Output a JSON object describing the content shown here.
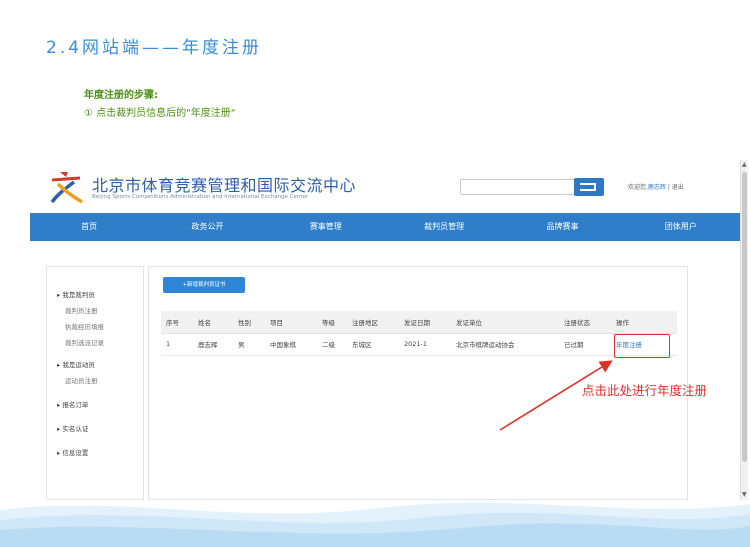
{
  "slide": {
    "title": "2.4网站端——年度注册",
    "steps_title": "年度注册的步骤:",
    "step1": "① 点击裁判员信息后的\"年度注册\""
  },
  "site": {
    "name_cn": "北京市体育竞赛管理和国际交流中心",
    "name_en": "Beijing Sports Competitions Administration and International Exchange Center",
    "welcome_prefix": "欢迎您,",
    "welcome_user": "鹿志辉",
    "welcome_sep": " | ",
    "logout": "退出"
  },
  "nav": [
    "首页",
    "政务公开",
    "赛事管理",
    "裁判员管理",
    "品牌赛事",
    "团体用户"
  ],
  "sidebar": {
    "groups": [
      {
        "label": "▸ 我是裁判员",
        "items": [
          "裁判员注册",
          "执裁经历填报",
          "裁判选派记录"
        ]
      },
      {
        "label": "▸ 我是运动员",
        "items": [
          "运动员注册"
        ]
      },
      {
        "label": "▸ 报名订单",
        "items": []
      },
      {
        "label": "▸ 实名认证",
        "items": []
      },
      {
        "label": "▸ 信息设置",
        "items": []
      }
    ]
  },
  "content": {
    "add_button": "+新增裁判员证书",
    "columns": [
      "序号",
      "姓名",
      "性别",
      "项目",
      "等级",
      "注册地区",
      "发证日期",
      "发证单位",
      "注册状态",
      "操作"
    ],
    "rows": [
      [
        "1",
        "鹿志辉",
        "男",
        "中国象棋",
        "二级",
        "东城区",
        "2021-1",
        "北京市棋牌运动协会",
        "已过期",
        "年度注册"
      ]
    ]
  },
  "annotation": "点击此处进行年度注册",
  "colors": {
    "accent": "#2f7ec9",
    "title": "#3a8ed6",
    "steps": "#4d8f12",
    "annotation": "#e0302a"
  }
}
